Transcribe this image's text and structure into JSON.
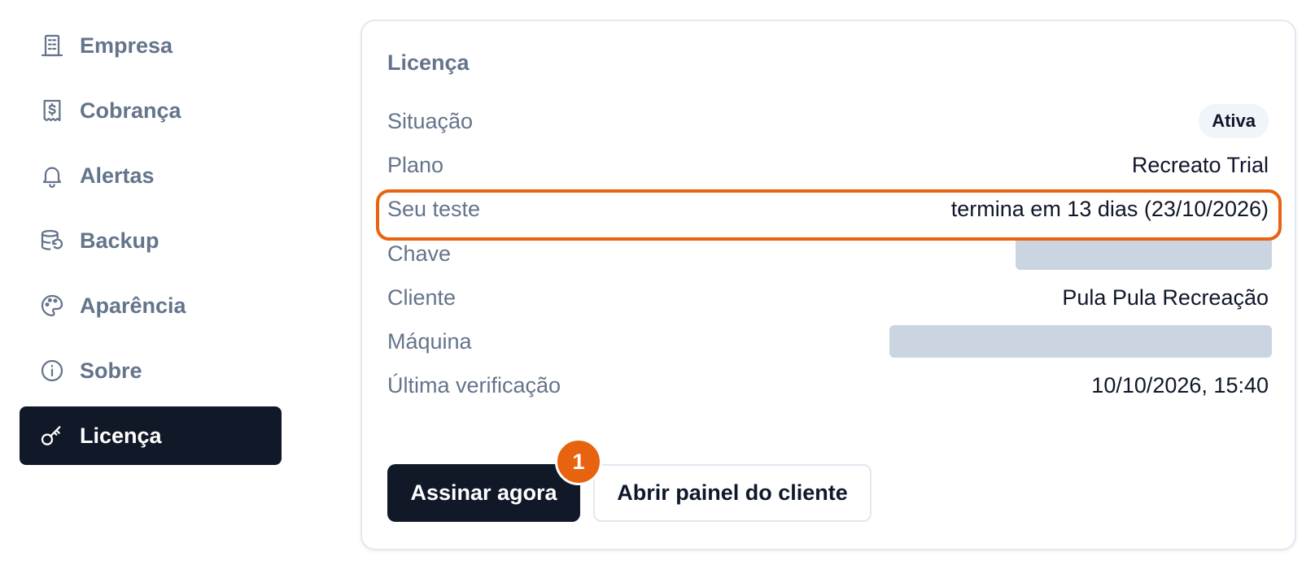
{
  "sidebar": {
    "items": [
      {
        "label": "Empresa",
        "icon": "building-icon"
      },
      {
        "label": "Cobrança",
        "icon": "receipt-dollar-icon"
      },
      {
        "label": "Alertas",
        "icon": "bell-icon"
      },
      {
        "label": "Backup",
        "icon": "database-restore-icon"
      },
      {
        "label": "Aparência",
        "icon": "palette-icon"
      },
      {
        "label": "Sobre",
        "icon": "info-icon"
      },
      {
        "label": "Licença",
        "icon": "key-icon",
        "active": true
      }
    ]
  },
  "license": {
    "title": "Licença",
    "status_label": "Situação",
    "status_value": "Ativa",
    "plan_label": "Plano",
    "plan_value": "Recreato Trial",
    "trial_label": "Seu teste",
    "trial_value": "termina em 13 dias (23/10/2026)",
    "key_label": "Chave",
    "client_label": "Cliente",
    "client_value": "Pula Pula Recreação",
    "machine_label": "Máquina",
    "last_check_label": "Última verificação",
    "last_check_value": "10/10/2026, 15:40"
  },
  "actions": {
    "subscribe_label": "Assinar agora",
    "client_panel_label": "Abrir painel do cliente"
  },
  "annotation": {
    "step_number": "1",
    "highlight_color": "#e8630f"
  },
  "colors": {
    "active_nav_bg": "#111827",
    "muted_text": "#64748b",
    "redaction": "#cbd5e1"
  }
}
